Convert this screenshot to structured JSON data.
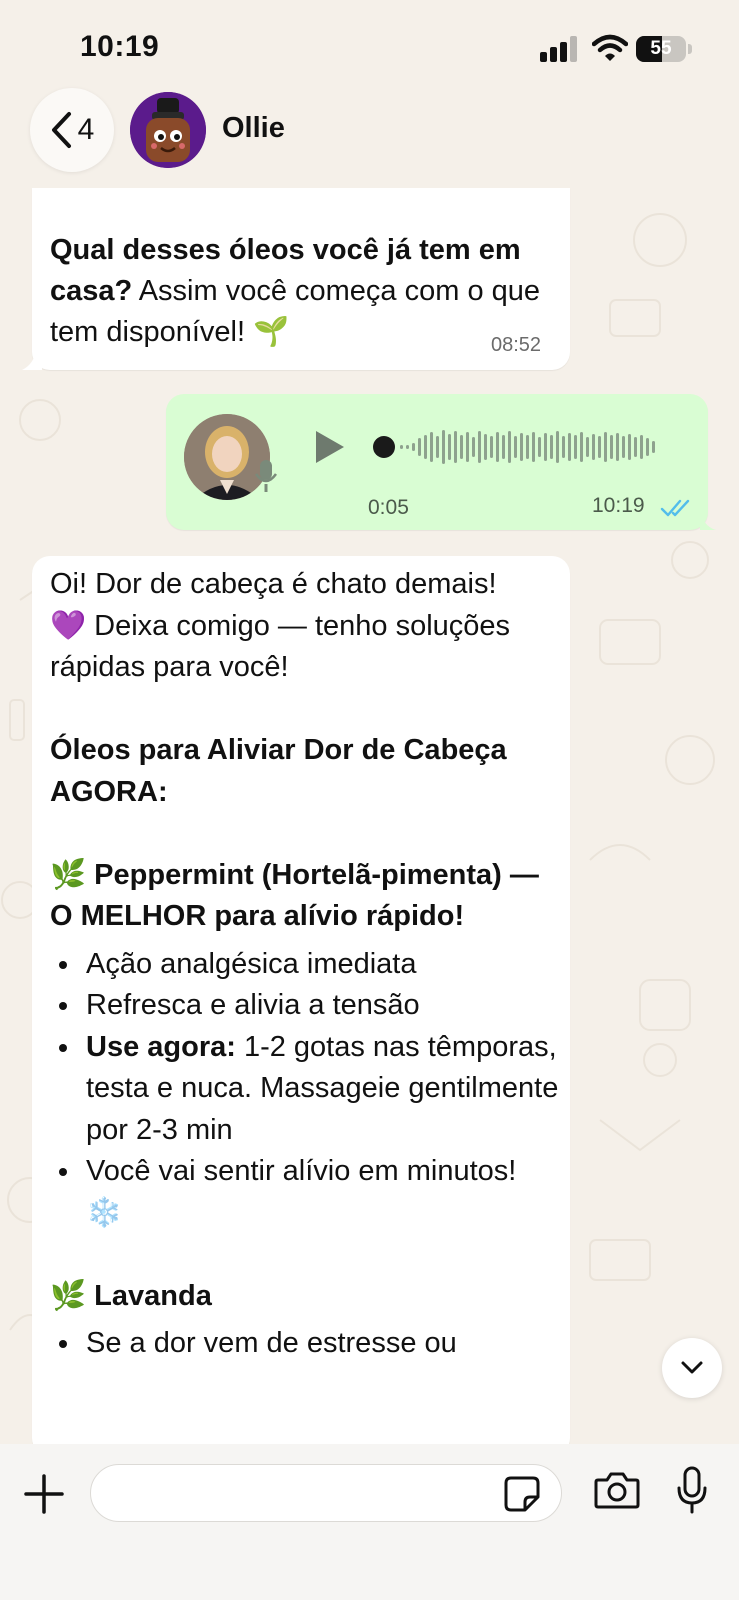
{
  "status_bar": {
    "time": "10:19",
    "battery_level": "55"
  },
  "header": {
    "back_count": "4",
    "contact_name": "Ollie"
  },
  "messages": {
    "first": {
      "bold_text": "Qual desses óleos você já tem em casa?",
      "text": " Assim você começa com o que tem disponível! 🌱",
      "time": "08:52"
    },
    "voice": {
      "duration": "0:05",
      "time": "10:19"
    },
    "reply": {
      "intro_line1": "Oi! Dor de cabeça é chato demais!",
      "intro_line2": "💜 Deixa comigo — tenho soluções rápidas para você!",
      "heading": "Óleos para Aliviar Dor de Cabeça AGORA:",
      "section1_title": "🌿 Peppermint (Hortelã-pimenta) — O MELHOR para alívio rápido!",
      "bullets1": [
        "Ação analgésica imediata",
        "Refresca e alivia a tensão",
        "1-2 gotas nas têmporas, testa e nuca. Massageie gentilmente por 2-3 min",
        "Você vai sentir alívio em minutos! ❄️"
      ],
      "bullet1_bold": "Use agora:",
      "section2_title": "🌿 Lavanda",
      "bullets2": [
        "Se a dor vem de estresse ou"
      ]
    }
  },
  "colors": {
    "incoming_bubble": "#ffffff",
    "outgoing_bubble": "#d9fdd3",
    "read_ticks": "#53bdeb",
    "background": "#f5f0e9"
  },
  "icons": {
    "back": "chevron-left-icon",
    "play": "play-icon",
    "mic": "microphone-icon",
    "camera": "camera-icon",
    "plus": "plus-icon",
    "sticker": "sticker-icon",
    "scroll": "chevron-down-icon"
  }
}
